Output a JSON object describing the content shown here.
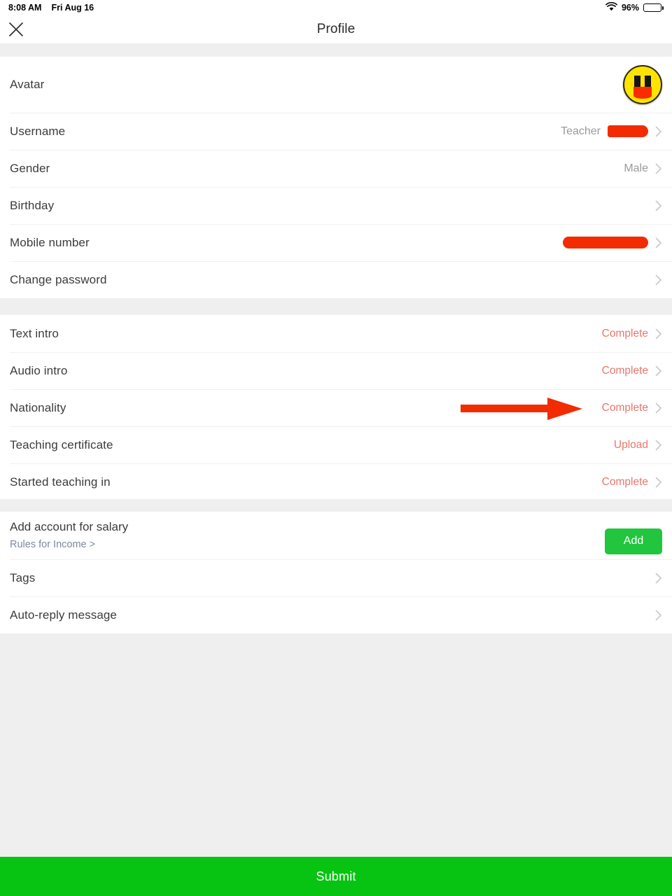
{
  "status_bar": {
    "time": "8:08 AM",
    "date": "Fri Aug 16",
    "battery_percent": "96%",
    "wifi_icon": "wifi-icon",
    "battery_icon": "battery-full-icon"
  },
  "nav": {
    "close_icon": "close-icon",
    "title": "Profile"
  },
  "colors": {
    "accent_green": "#06c411",
    "add_button_green": "#22c53e",
    "status_red": "#e8766c",
    "annotation_red": "#f32b00",
    "link_gray_blue": "#7c8a9c",
    "group_gap": "#efefef"
  },
  "groups": [
    {
      "id": "account-group",
      "rows": [
        {
          "name": "avatar",
          "label": "Avatar",
          "value": "",
          "type": "avatar",
          "chevron": false
        },
        {
          "name": "username",
          "label": "Username",
          "value": "Teacher",
          "type": "redacted-text",
          "chevron": true
        },
        {
          "name": "gender",
          "label": "Gender",
          "value": "Male",
          "type": "text",
          "chevron": true
        },
        {
          "name": "birthday",
          "label": "Birthday",
          "value": "",
          "type": "text",
          "chevron": true
        },
        {
          "name": "mobile-number",
          "label": "Mobile number",
          "value": "",
          "type": "redacted",
          "chevron": true
        },
        {
          "name": "change-password",
          "label": "Change password",
          "value": "",
          "type": "text",
          "chevron": true
        }
      ]
    },
    {
      "id": "teaching-group",
      "rows": [
        {
          "name": "text-intro",
          "label": "Text intro",
          "value": "Complete",
          "type": "status",
          "chevron": true
        },
        {
          "name": "audio-intro",
          "label": "Audio intro",
          "value": "Complete",
          "type": "status",
          "chevron": true
        },
        {
          "name": "nationality",
          "label": "Nationality",
          "value": "Complete",
          "type": "status",
          "chevron": true
        },
        {
          "name": "teaching-certificate",
          "label": "Teaching certificate",
          "value": "Upload",
          "type": "status",
          "chevron": true
        },
        {
          "name": "started-teaching-in",
          "label": "Started teaching in",
          "value": "Complete",
          "type": "status",
          "chevron": true
        }
      ]
    },
    {
      "id": "extras-group",
      "rows": [
        {
          "name": "add-account-for-salary",
          "label": "Add account for salary",
          "sublabel": "Rules for Income >",
          "value": "Add",
          "type": "salary",
          "chevron": false
        },
        {
          "name": "tags",
          "label": "Tags",
          "value": "",
          "type": "text",
          "chevron": true
        },
        {
          "name": "auto-reply-message",
          "label": "Auto-reply message",
          "value": "",
          "type": "text",
          "chevron": true
        }
      ]
    }
  ],
  "annotation": {
    "arrow_icon": "arrow-right-annotation",
    "points_at": "Nationality"
  },
  "submit": {
    "label": "Submit"
  }
}
